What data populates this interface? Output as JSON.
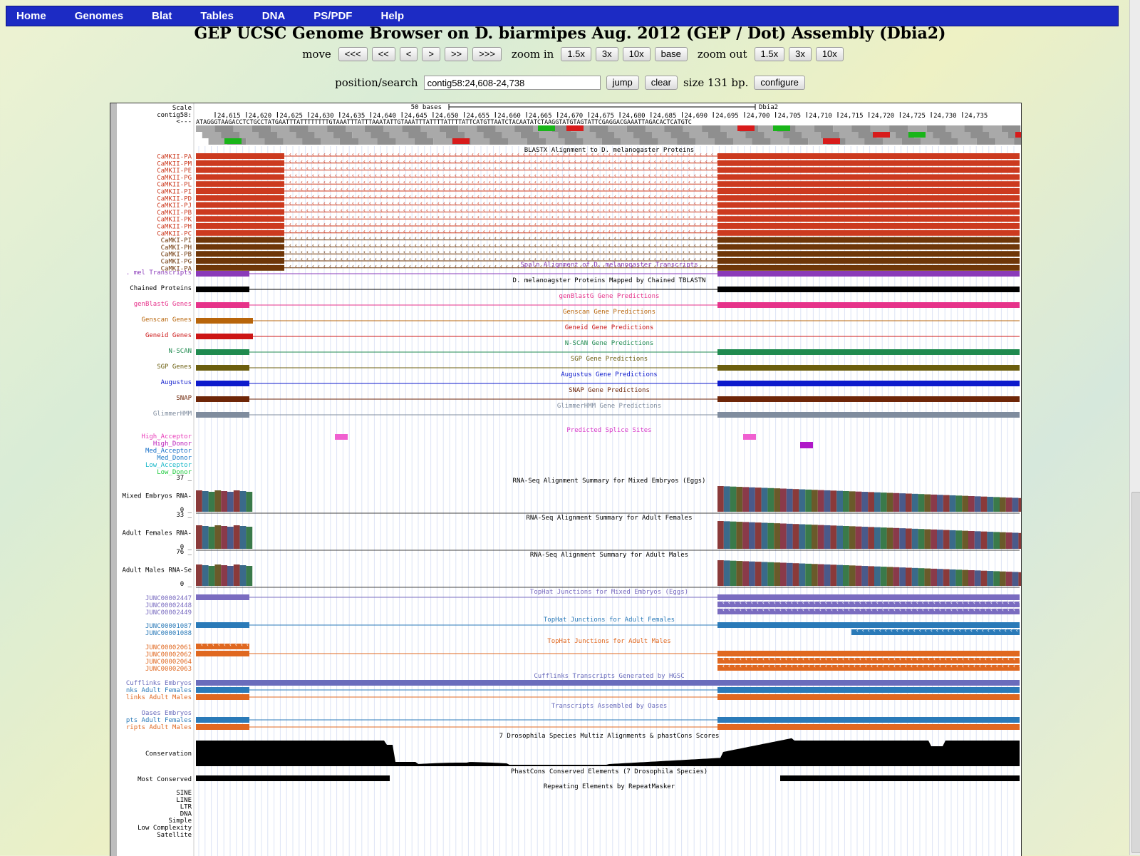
{
  "nav": [
    "Home",
    "Genomes",
    "Blat",
    "Tables",
    "DNA",
    "PS/PDF",
    "Help"
  ],
  "title": "GEP UCSC Genome Browser on D. biarmipes Aug. 2012 (GEP / Dot) Assembly (Dbia2)",
  "move": {
    "label": "move",
    "buttons": [
      "<<<",
      "<<",
      "<",
      ">",
      ">>",
      ">>>"
    ],
    "zoom_in_label": "zoom in",
    "zoom_in": [
      "1.5x",
      "3x",
      "10x",
      "base"
    ],
    "zoom_out_label": "zoom out",
    "zoom_out": [
      "1.5x",
      "3x",
      "10x"
    ]
  },
  "search": {
    "label": "position/search",
    "value": "contig58:24,608-24,738",
    "jump": "jump",
    "clear": "clear",
    "size": "size 131 bp.",
    "configure": "configure"
  },
  "ruler": {
    "scale_label": "Scale",
    "chrom_label": "contig58:",
    "strand_arrow": "<---",
    "bar_label": "50 bases",
    "assembly": "Dbia2",
    "ticks": [
      "24,615",
      "24,620",
      "24,625",
      "24,630",
      "24,635",
      "24,640",
      "24,645",
      "24,650",
      "24,655",
      "24,660",
      "24,665",
      "24,670",
      "24,675",
      "24,680",
      "24,685",
      "24,690",
      "24,695",
      "24,700",
      "24,705",
      "24,710",
      "24,715",
      "24,720",
      "24,725",
      "24,730",
      "24,735"
    ],
    "dna": "ATAGGGTAAGACCTCTGCCTATGAATTTATTTTTTTTGTAAATTTATTTAAATATTGTAAATTTATTTTATTTTATTCATGTTAATCTACAATATCTAAGGTATGTAGTATTCGAGGACGAAATTAGACACTCATGTC"
  },
  "tracks": {
    "blastx": {
      "title": "BLASTX Alignment to D. melanogaster Proteins",
      "labels": [
        "CaMKII-PA",
        "CaMKII-PM",
        "CaMKII-PE",
        "CaMKII-PG",
        "CaMKII-PL",
        "CaMKII-PI",
        "CaMKII-PD",
        "CaMKII-PJ",
        "CaMKII-PB",
        "CaMKII-PK",
        "CaMKII-PH",
        "CaMKII-PC",
        "CaMKI-PI",
        "CaMKI-PH",
        "CaMKI-PB",
        "CaMKI-PG",
        "CaMKI-PA"
      ]
    },
    "spaln": {
      "label": ". mel Transcripts",
      "title": "Spaln Alignment of D. melanogaster Transcripts"
    },
    "chained": {
      "label": "Chained Proteins",
      "title": "D. melanoagster Proteins Mapped by Chained TBLASTN"
    },
    "genblastg": {
      "label": "genBlastG Genes",
      "title": "genBlastG Gene Predictions"
    },
    "genscan": {
      "label": "Genscan Genes",
      "title": "Genscan Gene Predictions"
    },
    "geneid": {
      "label": "Geneid Genes",
      "title": "Geneid Gene Predictions"
    },
    "nscan": {
      "label": "N-SCAN",
      "title": "N-SCAN Gene Predictions"
    },
    "sgp": {
      "label": "SGP Genes",
      "title": "SGP Gene Predictions"
    },
    "augustus": {
      "label": "Augustus",
      "title": "Augustus Gene Predictions"
    },
    "snap": {
      "label": "SNAP",
      "title": "SNAP Gene Predictions"
    },
    "glimmer": {
      "label": "GlimmerHMM",
      "title": "GlimmerHMM Gene Predictions"
    },
    "splice": {
      "title": "Predicted Splice Sites",
      "labels": [
        "High_Acceptor",
        "High_Donor",
        "Med_Acceptor",
        "Med_Donor",
        "Low_Acceptor",
        "Low_Donor"
      ]
    },
    "rna_embryo": {
      "label": "Mixed Embryos RNA-",
      "title": "RNA-Seq Alignment Summary for Mixed Embryos (Eggs)",
      "max": "37 _",
      "min": "0 _"
    },
    "rna_female": {
      "label": "Adult Females RNA-",
      "title": "RNA-Seq Alignment Summary for Adult Females",
      "max": "33 _",
      "min": "0 _"
    },
    "rna_male": {
      "label": "Adult Males RNA-Se",
      "title": "RNA-Seq Alignment Summary for Adult Males",
      "max": "76 _",
      "min": "0 _"
    },
    "tophat_embryo": {
      "title": "TopHat Junctions for Mixed Embryos (Eggs)",
      "labels": [
        "JUNC00002447",
        "JUNC00002448",
        "JUNC00002449"
      ]
    },
    "tophat_female": {
      "title": "TopHat Junctions for Adult Females",
      "labels": [
        "JUNC00001087",
        "JUNC00001088"
      ]
    },
    "tophat_male": {
      "title": "TopHat Junctions for Adult Males",
      "labels": [
        "JUNC00002061",
        "JUNC00002062",
        "JUNC00002064",
        "JUNC00002063"
      ]
    },
    "cufflinks": {
      "title": "Cufflinks Transcripts Generated by HGSC",
      "labels": [
        "Cufflinks Embryos",
        "nks Adult Females",
        "links Adult Males"
      ]
    },
    "oases": {
      "title": "Transcripts Assembled by Oases",
      "labels": [
        "Oases Embryos",
        "pts Adult Females",
        "ripts Adult Males"
      ]
    },
    "conservation": {
      "label": "Conservation",
      "title": "7 Drosophila Species Multiz Alignments & phastCons Scores"
    },
    "most_conserved": {
      "label": "Most Conserved",
      "title": "PhastCons Conserved Elements (7 Drosophila Species)"
    },
    "repeatmasker": {
      "title": "Repeating Elements by RepeatMasker",
      "labels": [
        "SINE",
        "LINE",
        "LTR",
        "DNA",
        "Simple",
        "Low Complexity",
        "Satellite"
      ]
    }
  },
  "colors": {
    "nav_bg": "#1c2bc4",
    "blastx_red": "#cc3a1f",
    "blastx_brown": "#6e3608",
    "spaln": "#8a3ab9",
    "chained": "#000000",
    "genblastg": "#e6328a",
    "genscan": "#b8650b",
    "geneid": "#cc1515",
    "nscan": "#1f8a4f",
    "sgp": "#6b5e0e",
    "augustus": "#0d1acc",
    "snap": "#6e2608",
    "glimmer": "#7f8c9e",
    "tophat_embryo": "#7a6cc0",
    "tophat_female": "#2a7ab8",
    "tophat_male": "#e06820"
  }
}
